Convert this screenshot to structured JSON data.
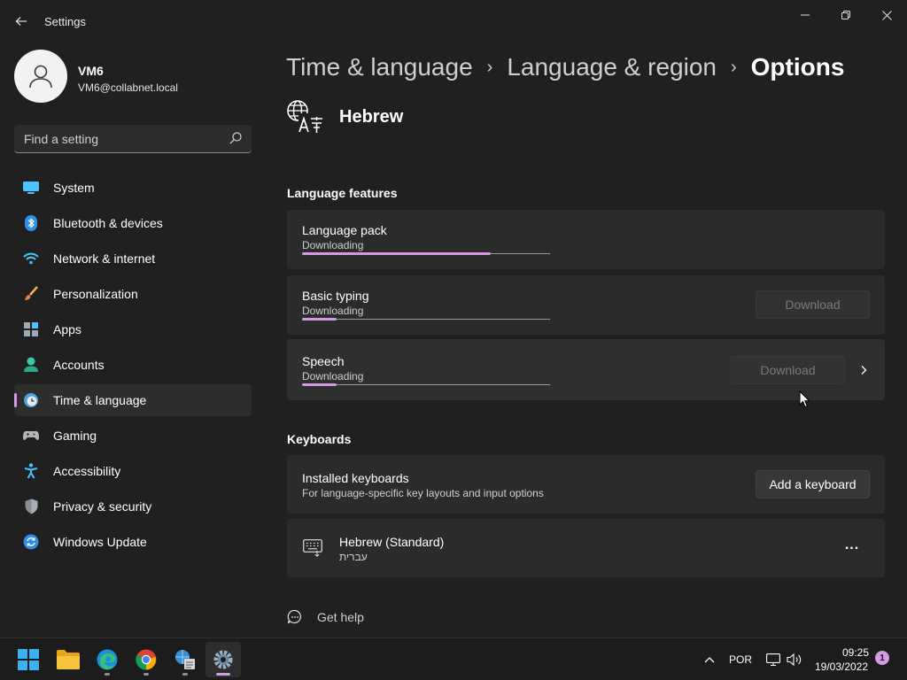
{
  "window": {
    "app_title": "Settings"
  },
  "profile": {
    "name": "VM6",
    "email": "VM6@collabnet.local"
  },
  "search": {
    "placeholder": "Find a setting"
  },
  "sidebar": {
    "items": [
      {
        "label": "System",
        "icon": "system-icon",
        "active": false
      },
      {
        "label": "Bluetooth & devices",
        "icon": "bluetooth-icon",
        "active": false
      },
      {
        "label": "Network & internet",
        "icon": "wifi-icon",
        "active": false
      },
      {
        "label": "Personalization",
        "icon": "brush-icon",
        "active": false
      },
      {
        "label": "Apps",
        "icon": "apps-icon",
        "active": false
      },
      {
        "label": "Accounts",
        "icon": "accounts-icon",
        "active": false
      },
      {
        "label": "Time & language",
        "icon": "time-language-icon",
        "active": true
      },
      {
        "label": "Gaming",
        "icon": "gaming-icon",
        "active": false
      },
      {
        "label": "Accessibility",
        "icon": "accessibility-icon",
        "active": false
      },
      {
        "label": "Privacy & security",
        "icon": "shield-icon",
        "active": false
      },
      {
        "label": "Windows Update",
        "icon": "update-icon",
        "active": false
      }
    ]
  },
  "breadcrumb": {
    "items": [
      "Time & language",
      "Language & region",
      "Options"
    ]
  },
  "language": {
    "name": "Hebrew"
  },
  "language_features": {
    "title": "Language features",
    "items": [
      {
        "title": "Language pack",
        "status": "Downloading",
        "progress": 0.76,
        "button": null
      },
      {
        "title": "Basic typing",
        "status": "Downloading",
        "progress": 0.14,
        "button": "Download"
      },
      {
        "title": "Speech",
        "status": "Downloading",
        "progress": 0.14,
        "button": "Download"
      }
    ]
  },
  "keyboards": {
    "title": "Keyboards",
    "installed_title": "Installed keyboards",
    "installed_sub": "For language-specific key layouts and input options",
    "add_button": "Add a keyboard",
    "items": [
      {
        "name": "Hebrew (Standard)",
        "native": "עברית",
        "more": "..."
      }
    ]
  },
  "help": {
    "label": "Get help"
  },
  "taskbar": {
    "apps": [
      "start-icon",
      "file-explorer-icon",
      "edge-icon",
      "chrome-icon",
      "network-app-icon",
      "settings-icon"
    ],
    "language": "POR",
    "time": "09:25",
    "date": "19/03/2022",
    "notification_count": "1"
  },
  "colors": {
    "background": "#202020",
    "card": "#2b2b2b",
    "accent": "#d59ae4"
  }
}
